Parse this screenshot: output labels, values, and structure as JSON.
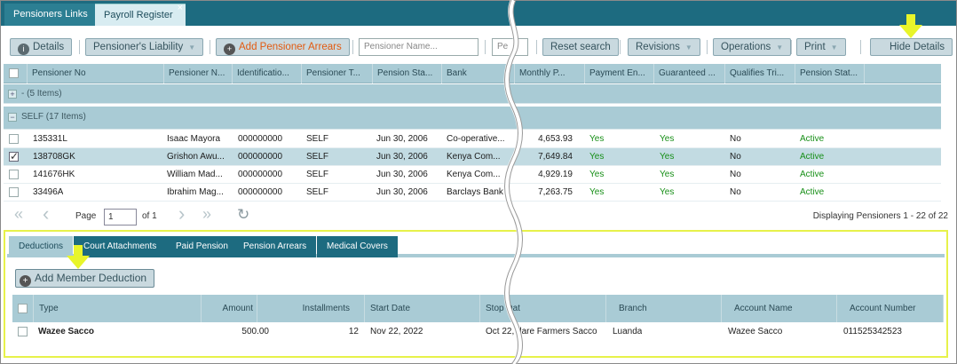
{
  "top_tabs": [
    {
      "label": "Pensioners Links"
    },
    {
      "label": "Payroll Register"
    }
  ],
  "top_tab_close": "×",
  "toolbar": {
    "details": "Details",
    "liability": "Pensioner's Liability",
    "add_arrears": "Add Pensioner Arrears",
    "name_placeholder": "Pensioner Name...",
    "second_input": "Pe",
    "reset": "Reset search",
    "revisions": "Revisions",
    "operations": "Operations",
    "print": "Print",
    "hide_details": "Hide Details"
  },
  "grid": {
    "columns": [
      "Pensioner No",
      "Pensioner N...",
      "Identificatio...",
      "Pensioner T...",
      "Pension Sta...",
      "Bank",
      "Monthly P...",
      "Payment En...",
      "Guaranteed ...",
      "Qualifies Tri...",
      "Pension Stat..."
    ],
    "groups": [
      {
        "toggle": "+",
        "label": "- (5 Items)"
      },
      {
        "toggle": "−",
        "label": "SELF (17 Items)"
      }
    ],
    "rows": [
      {
        "checked": false,
        "no": "135331L",
        "name": "Isaac Mayora",
        "id": "000000000",
        "type": "SELF",
        "start": "Jun 30, 2006",
        "bank": "Co-operative...",
        "monthly": "4,653.93",
        "payment": "Yes",
        "guaranteed": "Yes",
        "qualifies": "No",
        "status": "Active"
      },
      {
        "checked": true,
        "no": "138708GK",
        "name": "Grishon Awu...",
        "id": "000000000",
        "type": "SELF",
        "start": "Jun 30, 2006",
        "bank": "Kenya Com...",
        "monthly": "7,649.84",
        "payment": "Yes",
        "guaranteed": "Yes",
        "qualifies": "No",
        "status": "Active"
      },
      {
        "checked": false,
        "no": "141676HK",
        "name": "William Mad...",
        "id": "000000000",
        "type": "SELF",
        "start": "Jun 30, 2006",
        "bank": "Kenya Com...",
        "monthly": "4,929.19",
        "payment": "Yes",
        "guaranteed": "Yes",
        "qualifies": "No",
        "status": "Active"
      },
      {
        "checked": false,
        "no": "33496A",
        "name": "Ibrahim Mag...",
        "id": "000000000",
        "type": "SELF",
        "start": "Jun 30, 2006",
        "bank": "Barclays Bank",
        "monthly": "7,263.75",
        "payment": "Yes",
        "guaranteed": "Yes",
        "qualifies": "No",
        "status": "Active"
      }
    ],
    "check_mark": "✓"
  },
  "pager": {
    "first": "«",
    "prev": "‹",
    "page_label": "Page",
    "page_value": "1",
    "of_label": "of 1",
    "next": "›",
    "last": "»",
    "refresh": "↻",
    "summary": "Displaying Pensioners 1 - 22 of 22"
  },
  "details": {
    "tabs": [
      "Deductions",
      "Court Attachments",
      "Paid Pension",
      "Pension Arrears",
      "Medical Covers"
    ],
    "add_button": "Add Member Deduction",
    "columns": [
      "Type",
      "Amount",
      "Installments",
      "Start Date",
      "Stop Dat",
      "Branch",
      "Account Name",
      "Account Number"
    ],
    "row": {
      "type": "Wazee Sacco",
      "amount": "500.00",
      "installments": "12",
      "start": "Nov 22, 2022",
      "stop_and_bank": "Oct 22, dare Farmers Sacco",
      "branch": "Luanda",
      "account_name": "Wazee Sacco",
      "account_number": "011525342523"
    }
  },
  "colors": {
    "tab_bar": "#1d6b80",
    "header": "#a9cbd5",
    "highlight_border": "#e7f24a",
    "arrow": "#e8f52a",
    "green_text": "#178f17",
    "accent_orange": "#e25a10"
  }
}
